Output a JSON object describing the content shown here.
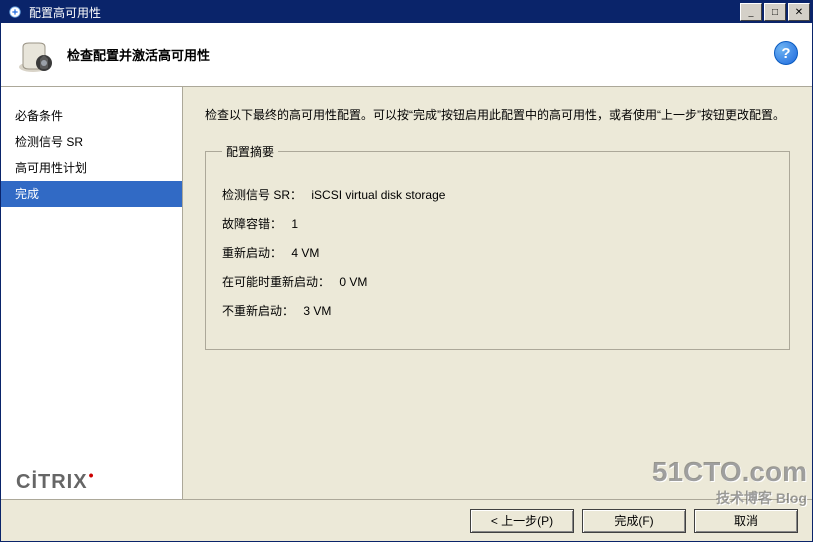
{
  "window": {
    "title": "配置高可用性"
  },
  "header": {
    "title": "检查配置并激活高可用性"
  },
  "sidebar": {
    "items": [
      {
        "label": "必备条件",
        "active": false
      },
      {
        "label": "检测信号 SR",
        "active": false
      },
      {
        "label": "高可用性计划",
        "active": false
      },
      {
        "label": "完成",
        "active": true
      }
    ]
  },
  "main": {
    "instruction": "检查以下最终的高可用性配置。可以按“完成”按钮启用此配置中的高可用性，或者使用“上一步”按钮更改配置。",
    "summary": {
      "legend": "配置摘要",
      "rows": [
        {
          "label": "检测信号 SR：",
          "value": "iSCSI virtual disk storage"
        },
        {
          "label": "故障容错：",
          "value": "1"
        },
        {
          "label": "重新启动：",
          "value": "4 VM"
        },
        {
          "label": "在可能时重新启动：",
          "value": "0 VM"
        },
        {
          "label": "不重新启动：",
          "value": "3 VM"
        }
      ]
    }
  },
  "footer": {
    "back": "< 上一步(P)",
    "finish": "完成(F)",
    "cancel": "取消"
  },
  "branding": {
    "citrix": "CİTRIX"
  },
  "watermark": {
    "main": "51CTO.com",
    "sub": "技术博客 Blog"
  }
}
